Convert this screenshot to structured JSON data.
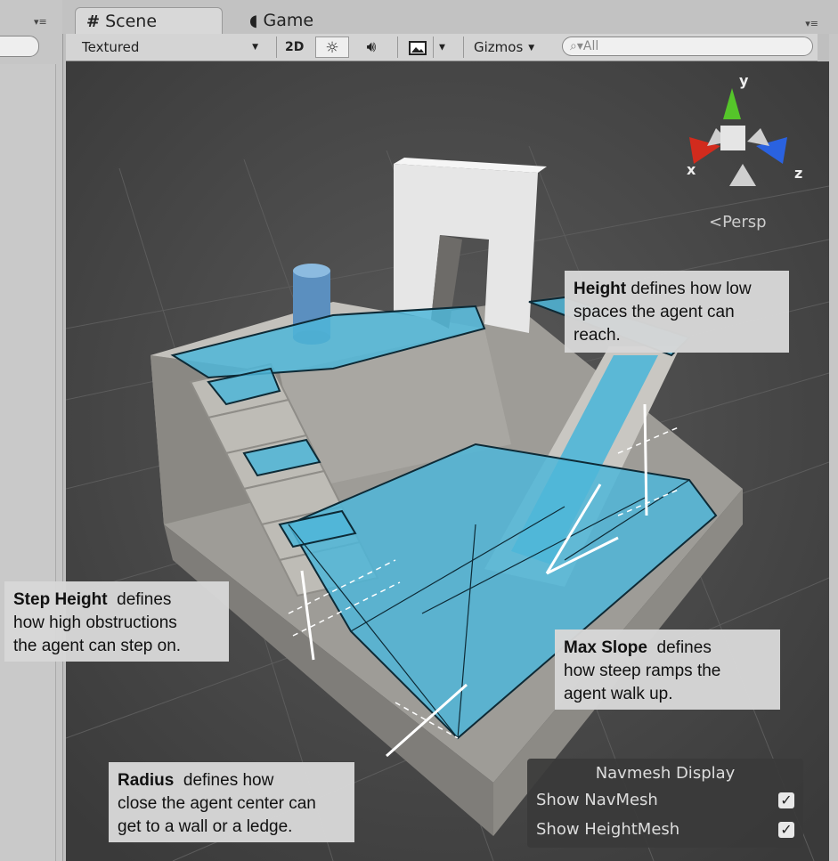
{
  "tabs": {
    "scene_label": "Scene",
    "scene_icon": "grid-icon",
    "game_label": "Game",
    "game_icon": "pacman-icon"
  },
  "toolbar": {
    "render_mode": "Textured",
    "mode_2d": "2D",
    "gizmos_label": "Gizmos",
    "search_placeholder": "All"
  },
  "gizmo": {
    "axis_y": "y",
    "axis_x": "x",
    "axis_z": "z",
    "projection": "Persp"
  },
  "callouts": {
    "height": {
      "term": "Height",
      "rest_line1": "defines how low",
      "line2": "spaces the agent can",
      "line3": "reach."
    },
    "step_height": {
      "term": "Step Height",
      "rest_line1": "defines",
      "line2": "how high obstructions",
      "line3": "the agent can step on."
    },
    "max_slope": {
      "term": "Max Slope",
      "rest_line1": "defines",
      "line2": "how steep ramps the",
      "line3": "agent walk up."
    },
    "radius": {
      "term": "Radius",
      "rest_line1": "defines how",
      "line2": "close the agent center can",
      "line3": "get to a wall or a ledge."
    }
  },
  "navmesh_display": {
    "title": "Navmesh Display",
    "show_navmesh_label": "Show NavMesh",
    "show_navmesh_checked": true,
    "show_heightmesh_label": "Show HeightMesh",
    "show_heightmesh_checked": true
  },
  "colors": {
    "navmesh": "#4fb6d8",
    "geometry": "#b9b7b1",
    "background": "#444444"
  }
}
